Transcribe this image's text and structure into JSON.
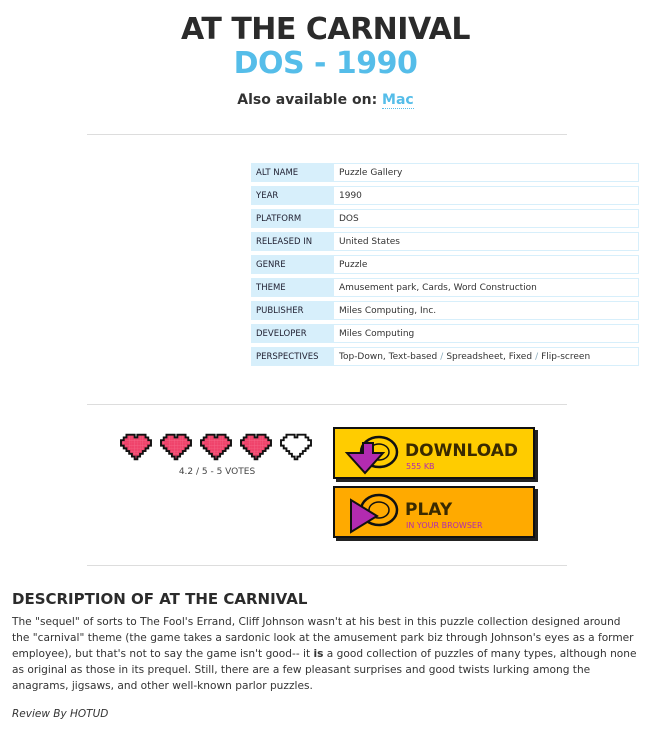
{
  "title": "AT THE CARNIVAL",
  "subtitle": "DOS - 1990",
  "also_available": {
    "label": "Also available on:",
    "platform": "Mac"
  },
  "info": [
    {
      "key": "ALT NAME",
      "value": "Puzzle Gallery"
    },
    {
      "key": "YEAR",
      "value": "1990"
    },
    {
      "key": "PLATFORM",
      "value": "DOS"
    },
    {
      "key": "RELEASED IN",
      "value": "United States"
    },
    {
      "key": "GENRE",
      "value": "Puzzle"
    },
    {
      "key": "THEME",
      "value": "Amusement park, Cards, Word Construction"
    },
    {
      "key": "PUBLISHER",
      "value": "Miles Computing, Inc."
    },
    {
      "key": "DEVELOPER",
      "value": "Miles Computing"
    },
    {
      "key": "PERSPECTIVES",
      "value": [
        "Top-Down, Text-based",
        "Spreadsheet, Fixed",
        "Flip-screen"
      ]
    }
  ],
  "rating": {
    "text": "4.2 / 5 - 5 VOTES",
    "value": 4.2,
    "max": 5,
    "filled_color": "#f0436b"
  },
  "download": {
    "label": "DOWNLOAD",
    "size": "555 KB"
  },
  "play": {
    "label": "PLAY",
    "sub": "IN YOUR BROWSER"
  },
  "description": {
    "heading": "DESCRIPTION OF AT THE CARNIVAL",
    "text_before_bold": "The \"sequel\" of sorts to The Fool's Errand, Cliff Johnson wasn't at his best in this puzzle collection designed around the \"carnival\" theme (the game takes a sardonic look at the amusement park biz through Johnson's eyes as a former employee), but that's not to say the game isn't good-- it ",
    "bold": "is",
    "text_after_bold": " a good collection of puzzles of many types, although none as original as those in its prequel. Still, there are a few pleasant surprises and good twists lurking among the anagrams, jigsaws, and other well-known parlor puzzles.",
    "review": "Review By HOTUD"
  }
}
